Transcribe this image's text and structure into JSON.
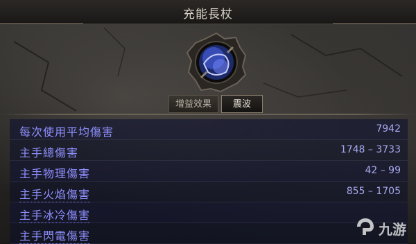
{
  "window": {
    "title": "充能長杖"
  },
  "tabs": [
    {
      "label": "增益效果",
      "active": false
    },
    {
      "label": "震波",
      "active": true
    }
  ],
  "stats": [
    {
      "label": "每次使用平均傷害",
      "value": "7942"
    },
    {
      "label": "主手總傷害",
      "value": "1748 – 3733"
    },
    {
      "label": "主手物理傷害",
      "value": "42 – 99"
    },
    {
      "label": "主手火焰傷害",
      "value": "855 – 1705"
    },
    {
      "label": "主手冰冷傷害",
      "value": ""
    },
    {
      "label": "主手閃電傷害",
      "value": ""
    }
  ],
  "watermark": {
    "text": "九游",
    "icon": "jiuyou-logo-icon"
  },
  "colors": {
    "stat_label": "#8f90ff",
    "stat_value": "#a8a9f0",
    "title": "#d9d3c7"
  }
}
